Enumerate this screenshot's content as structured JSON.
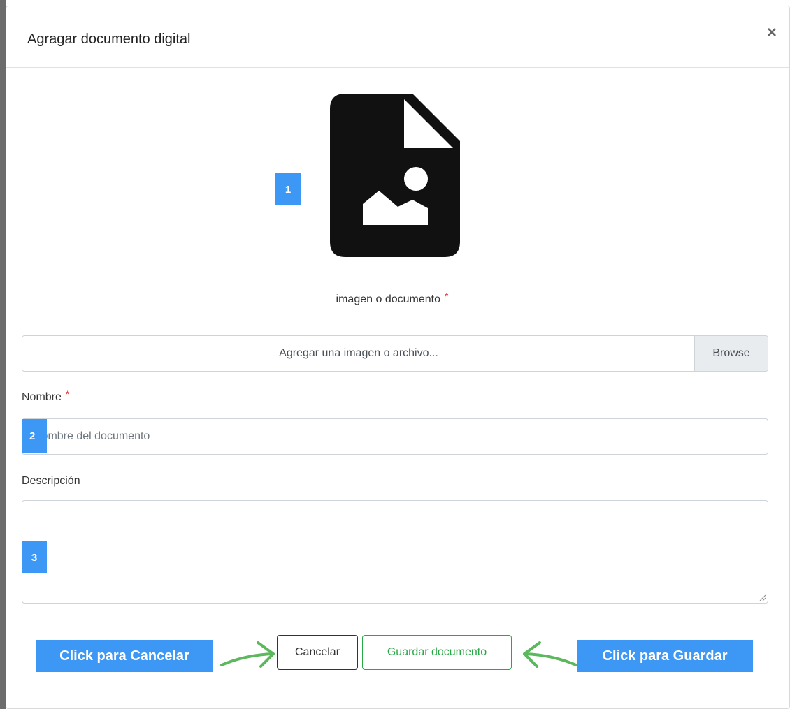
{
  "modal": {
    "title": "Agragar documento digital",
    "close_symbol": "×"
  },
  "file_section": {
    "icon": "file-image-icon",
    "label": "imagen o documento",
    "required_marker": "*",
    "placeholder": "Agregar una imagen o archivo...",
    "browse_label": "Browse"
  },
  "nombre": {
    "label": "Nombre",
    "required_marker": "*",
    "placeholder": "Nombre del documento"
  },
  "descripcion": {
    "label": "Descripción",
    "value": ""
  },
  "badges": {
    "one": "1",
    "two": "2",
    "three": "3"
  },
  "footer": {
    "cancel_label": "Cancelar",
    "save_label": "Guardar documento",
    "callout_cancel": "Click para Cancelar",
    "callout_save": "Click para Guardar"
  },
  "colors": {
    "badge_blue": "#3d97f5",
    "save_green": "#28a745",
    "arrow_green": "#5cb85c",
    "required_red": "#e53935"
  }
}
